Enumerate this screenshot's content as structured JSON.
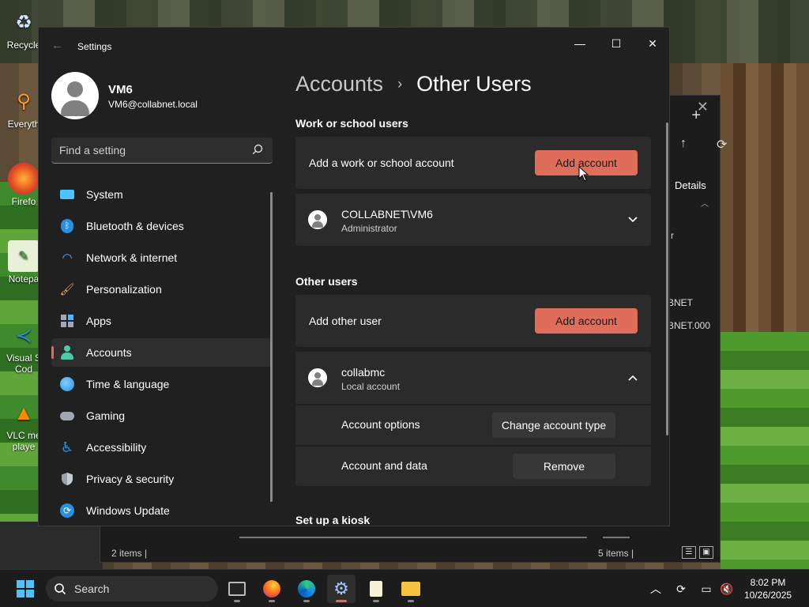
{
  "desktop": {
    "icons": [
      {
        "label": "Recycle",
        "icon": "recycle-bin-icon"
      },
      {
        "label": "Everyth",
        "icon": "everything-search-icon"
      },
      {
        "label": "Firefo",
        "icon": "firefox-icon"
      },
      {
        "label": "Notepa",
        "icon": "notepad-icon"
      },
      {
        "label": "Visual S Cod",
        "icon": "vscode-icon"
      },
      {
        "label": "VLC me playe",
        "icon": "vlc-icon"
      }
    ]
  },
  "explorer": {
    "details_label": "Details",
    "row1": "r",
    "row2": "BNET",
    "row3": "BNET.000",
    "status_left": "2 items  |",
    "status_right": "5 items  |"
  },
  "settings": {
    "app_title": "Settings",
    "user": {
      "name": "VM6",
      "email": "VM6@collabnet.local"
    },
    "search": {
      "placeholder": "Find a setting"
    },
    "nav": [
      {
        "label": "System",
        "icon": "system-monitor-icon",
        "color": "#4cc2ff"
      },
      {
        "label": "Bluetooth & devices",
        "icon": "bluetooth-icon",
        "color": "#2a8fe0"
      },
      {
        "label": "Network & internet",
        "icon": "wifi-icon",
        "color": "#5ab0f0"
      },
      {
        "label": "Personalization",
        "icon": "paintbrush-icon",
        "color": "#e0a96d"
      },
      {
        "label": "Apps",
        "icon": "apps-icon",
        "color": "#a0a8b8"
      },
      {
        "label": "Accounts",
        "icon": "person-icon",
        "color": "#4ec9a8",
        "active": true
      },
      {
        "label": "Time & language",
        "icon": "globe-clock-icon",
        "color": "#3ea8e0"
      },
      {
        "label": "Gaming",
        "icon": "gamepad-icon",
        "color": "#a0a8b8"
      },
      {
        "label": "Accessibility",
        "icon": "accessibility-icon",
        "color": "#2a8fe0"
      },
      {
        "label": "Privacy & security",
        "icon": "shield-icon",
        "color": "#9aa0a8"
      },
      {
        "label": "Windows Update",
        "icon": "update-icon",
        "color": "#2a8fe0"
      }
    ],
    "breadcrumb": {
      "parent": "Accounts",
      "separator": "›",
      "current": "Other Users"
    },
    "work_section": {
      "title": "Work or school users",
      "add_label": "Add a work or school account",
      "add_button": "Add account",
      "account": {
        "name": "COLLABNET\\VM6",
        "type": "Administrator"
      }
    },
    "other_section": {
      "title": "Other users",
      "add_label": "Add other user",
      "add_button": "Add account",
      "account": {
        "name": "collabmc",
        "type": "Local account"
      },
      "options_label": "Account options",
      "options_button": "Change account type",
      "data_label": "Account and data",
      "data_button": "Remove"
    },
    "kiosk_title": "Set up a kiosk",
    "accent_color": "#e06c5a"
  },
  "taskbar": {
    "search_label": "Search",
    "apps": [
      {
        "name": "terminal-app-icon"
      },
      {
        "name": "firefox-app-icon"
      },
      {
        "name": "edge-app-icon"
      },
      {
        "name": "settings-app-icon",
        "active": true
      },
      {
        "name": "notepad-app-icon"
      },
      {
        "name": "file-explorer-app-icon"
      }
    ],
    "time": "8:02 PM",
    "date": "10/26/2025"
  }
}
